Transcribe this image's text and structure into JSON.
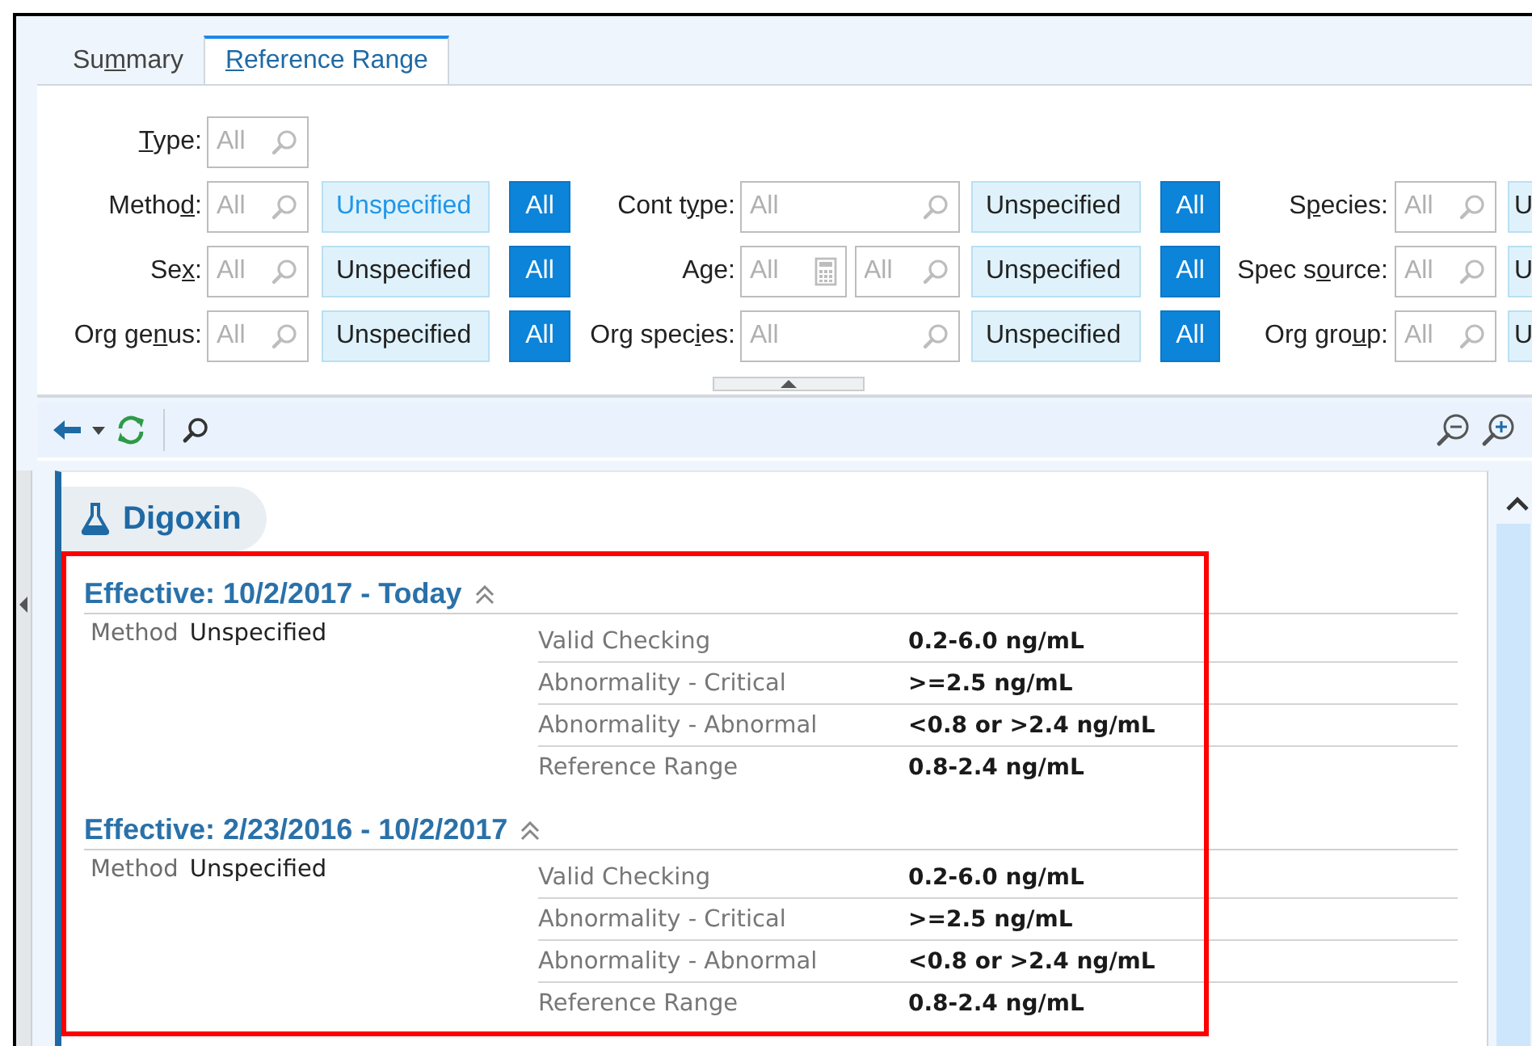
{
  "tabs": [
    {
      "label": {
        "before": "Su",
        "key": "m",
        "after": "mary"
      },
      "selected": false
    },
    {
      "label": {
        "key": "R",
        "after": "eference Range"
      },
      "selected": true
    }
  ],
  "filters": {
    "rows": [
      {
        "groups": [
          {
            "label": {
              "key": "T",
              "after": "ype:"
            },
            "fields": [
              {
                "placeholder": "All",
                "kind": "search"
              }
            ]
          }
        ]
      },
      {
        "groups": [
          {
            "label": {
              "before": "Metho",
              "key": "d",
              "after": ":"
            },
            "fields": [
              {
                "placeholder": "All",
                "kind": "search"
              }
            ],
            "buttons": [
              {
                "label": "Unspecified",
                "selected": false,
                "hover": true
              },
              {
                "label": "All",
                "selected": true,
                "hover": false
              }
            ]
          },
          {
            "label": {
              "before": "Cont t",
              "key": "y",
              "after": "pe:"
            },
            "fields": [
              {
                "placeholder": "All",
                "kind": "search"
              }
            ],
            "buttons": [
              {
                "label": "Unspecified",
                "selected": false,
                "hover": false
              },
              {
                "label": "All",
                "selected": true,
                "hover": false
              }
            ]
          },
          {
            "label": {
              "before": "S",
              "key": "p",
              "after": "ecies:"
            },
            "fields": [
              {
                "placeholder": "All",
                "kind": "search"
              }
            ],
            "buttons": [
              {
                "label": "U",
                "selected": false,
                "hover": false
              }
            ]
          }
        ]
      },
      {
        "groups": [
          {
            "label": {
              "before": "Se",
              "key": "x",
              "after": ":"
            },
            "fields": [
              {
                "placeholder": "All",
                "kind": "search"
              }
            ],
            "buttons": [
              {
                "label": "Unspecified",
                "selected": false,
                "hover": false
              },
              {
                "label": "All",
                "selected": true,
                "hover": false
              }
            ]
          },
          {
            "label": {
              "before": "A",
              "key": "g",
              "after": "e:"
            },
            "fields": [
              {
                "placeholder": "All",
                "kind": "calculator"
              },
              {
                "placeholder": "All",
                "kind": "search"
              }
            ],
            "buttons": [
              {
                "label": "Unspecified",
                "selected": false,
                "hover": false
              },
              {
                "label": "All",
                "selected": true,
                "hover": false
              }
            ]
          },
          {
            "label": {
              "before": "Spec s",
              "key": "o",
              "after": "urce:"
            },
            "fields": [
              {
                "placeholder": "All",
                "kind": "search"
              }
            ],
            "buttons": [
              {
                "label": "U",
                "selected": false,
                "hover": false
              }
            ]
          }
        ]
      },
      {
        "groups": [
          {
            "label": {
              "before": "Org ge",
              "key": "n",
              "after": "us:"
            },
            "fields": [
              {
                "placeholder": "All",
                "kind": "search"
              }
            ],
            "buttons": [
              {
                "label": "Unspecified",
                "selected": false,
                "hover": false
              },
              {
                "label": "All",
                "selected": true,
                "hover": false
              }
            ]
          },
          {
            "label": {
              "before": "Org spec",
              "key": "i",
              "after": "es:"
            },
            "fields": [
              {
                "placeholder": "All",
                "kind": "search"
              }
            ],
            "buttons": [
              {
                "label": "Unspecified",
                "selected": false,
                "hover": false
              },
              {
                "label": "All",
                "selected": true,
                "hover": false
              }
            ]
          },
          {
            "label": {
              "before": "Org gro",
              "key": "u",
              "after": "p:"
            },
            "fields": [
              {
                "placeholder": "All",
                "kind": "search"
              }
            ],
            "buttons": [
              {
                "label": "U",
                "selected": false,
                "hover": false
              }
            ]
          }
        ]
      }
    ]
  },
  "result": {
    "title": "Digoxin",
    "sections": [
      {
        "heading": "Effective: 10/2/2017 - Today",
        "expanded": true,
        "method_label": "Method",
        "method_value": "Unspecified",
        "rows": [
          {
            "label": "Valid Checking",
            "value": "0.2-6.0 ng/mL"
          },
          {
            "label": "Abnormality - Critical",
            "value": ">=2.5 ng/mL"
          },
          {
            "label": "Abnormality - Abnormal",
            "value": "<0.8 or >2.4 ng/mL"
          },
          {
            "label": "Reference Range",
            "value": "0.8-2.4 ng/mL"
          }
        ]
      },
      {
        "heading": "Effective: 2/23/2016 - 10/2/2017",
        "expanded": true,
        "method_label": "Method",
        "method_value": "Unspecified",
        "rows": [
          {
            "label": "Valid Checking",
            "value": "0.2-6.0 ng/mL"
          },
          {
            "label": "Abnormality - Critical",
            "value": ">=2.5 ng/mL"
          },
          {
            "label": "Abnormality - Abnormal",
            "value": "<0.8 or >2.4 ng/mL"
          },
          {
            "label": "Reference Range",
            "value": "0.8-2.4 ng/mL"
          }
        ]
      }
    ]
  }
}
